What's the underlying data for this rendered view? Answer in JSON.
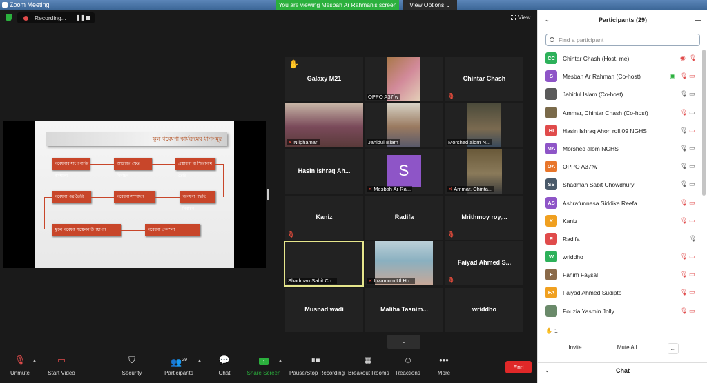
{
  "window": {
    "title": "Zoom Meeting"
  },
  "banner": {
    "viewing": "You are viewing Mesbah Ar Rahman's screen",
    "view_options": "View Options ⌄"
  },
  "meeting": {
    "recording_label": "Recording...",
    "view_label": "View"
  },
  "slide": {
    "title": "স্কুল গবেষণা কার্যক্রমের ধাপসমূহ",
    "boxes": [
      "গবেষণার ধাপে ব্যক্তি কর্মশালা",
      "আগ্রহের ক্ষেত্র নির্বাচন",
      "প্রস্তাবনা বা শিরোনাম তৈরি",
      "গবেষণা পত্র তৈরি",
      "গবেষণা সম্পাদন",
      "গবেষণা পদ্ধতি নির্বাচন",
      "স্কুলে গবেষক সম্মেলন উপস্থাপন",
      "গবেষণা প্রকাশনা"
    ]
  },
  "video": {
    "tiles": [
      {
        "name": "Galaxy M21",
        "label": ""
      },
      {
        "name": "",
        "label": "OPPO A37fw"
      },
      {
        "name": "Chintar Chash",
        "label": ""
      },
      {
        "name": "",
        "label": "Nilphamari"
      },
      {
        "name": "",
        "label": "Jahidul Islam"
      },
      {
        "name": "",
        "label": "Morshed alom N..."
      },
      {
        "name": "Hasin Ishraq Ah...",
        "label": ""
      },
      {
        "name": "",
        "label": "Mesbah Ar Ra..."
      },
      {
        "name": "",
        "label": "Ammar, Chinta..."
      },
      {
        "name": "Kaniz",
        "label": ""
      },
      {
        "name": "Radifa",
        "label": ""
      },
      {
        "name": "Mrithmoy  roy,...",
        "label": ""
      },
      {
        "name": "",
        "label": "Shadman Sabit Ch..."
      },
      {
        "name": "",
        "label": "Inzamum Ul Hu..."
      },
      {
        "name": "Faiyad Ahmed S...",
        "label": ""
      },
      {
        "name": "Musnad wadi",
        "label": ""
      },
      {
        "name": "Maliha  Tasnim...",
        "label": ""
      },
      {
        "name": "wriddho",
        "label": ""
      }
    ],
    "s_avatar": "S"
  },
  "toolbar": {
    "unmute": "Unmute",
    "start_video": "Start Video",
    "security": "Security",
    "participants": "Participants",
    "participants_count": "29",
    "chat": "Chat",
    "share_screen": "Share Screen",
    "pause_recording": "Pause/Stop Recording",
    "breakout": "Breakout Rooms",
    "reactions": "Reactions",
    "more": "More",
    "end": "End"
  },
  "panel": {
    "title": "Participants (29)",
    "search_placeholder": "Find a participant",
    "participants": [
      {
        "initials": "CC",
        "color": "#2db15a",
        "name": "Chintar Chash (Host, me)"
      },
      {
        "initials": "S",
        "color": "#8e55c7",
        "name": "Mesbah Ar Rahman (Co-host)"
      },
      {
        "initials": "",
        "color": "#5a5a5a",
        "name": "Jahidul Islam (Co-host)"
      },
      {
        "initials": "",
        "color": "#7a6a4a",
        "name": "Ammar, Chintar Chash (Co-host)"
      },
      {
        "initials": "HI",
        "color": "#e04b4b",
        "name": "Hasin Ishraq Ahon roll,09 NGHS"
      },
      {
        "initials": "MA",
        "color": "#8e55c7",
        "name": "Morshed alom NGHS"
      },
      {
        "initials": "OA",
        "color": "#e8762b",
        "name": "OPPO A37fw"
      },
      {
        "initials": "SS",
        "color": "#4a5a6a",
        "name": "Shadman Sabit Chowdhury"
      },
      {
        "initials": "AS",
        "color": "#8e55c7",
        "name": "Ashrafunnesa Siddika Reefa"
      },
      {
        "initials": "K",
        "color": "#f0a020",
        "name": "Kaniz"
      },
      {
        "initials": "R",
        "color": "#e04b4b",
        "name": "Radifa"
      },
      {
        "initials": "W",
        "color": "#2db15a",
        "name": "wriddho"
      },
      {
        "initials": "F",
        "color": "#8a6a4a",
        "name": "Fahim Faysal"
      },
      {
        "initials": "FA",
        "color": "#f0a020",
        "name": "Faiyad Ahmed Sudipto"
      },
      {
        "initials": "",
        "color": "#6a8a6a",
        "name": "Fouzia Yasmin Jolly"
      }
    ],
    "raised_hands": "1",
    "invite": "Invite",
    "mute_all": "Mute All",
    "more": "...",
    "chat_title": "Chat"
  }
}
